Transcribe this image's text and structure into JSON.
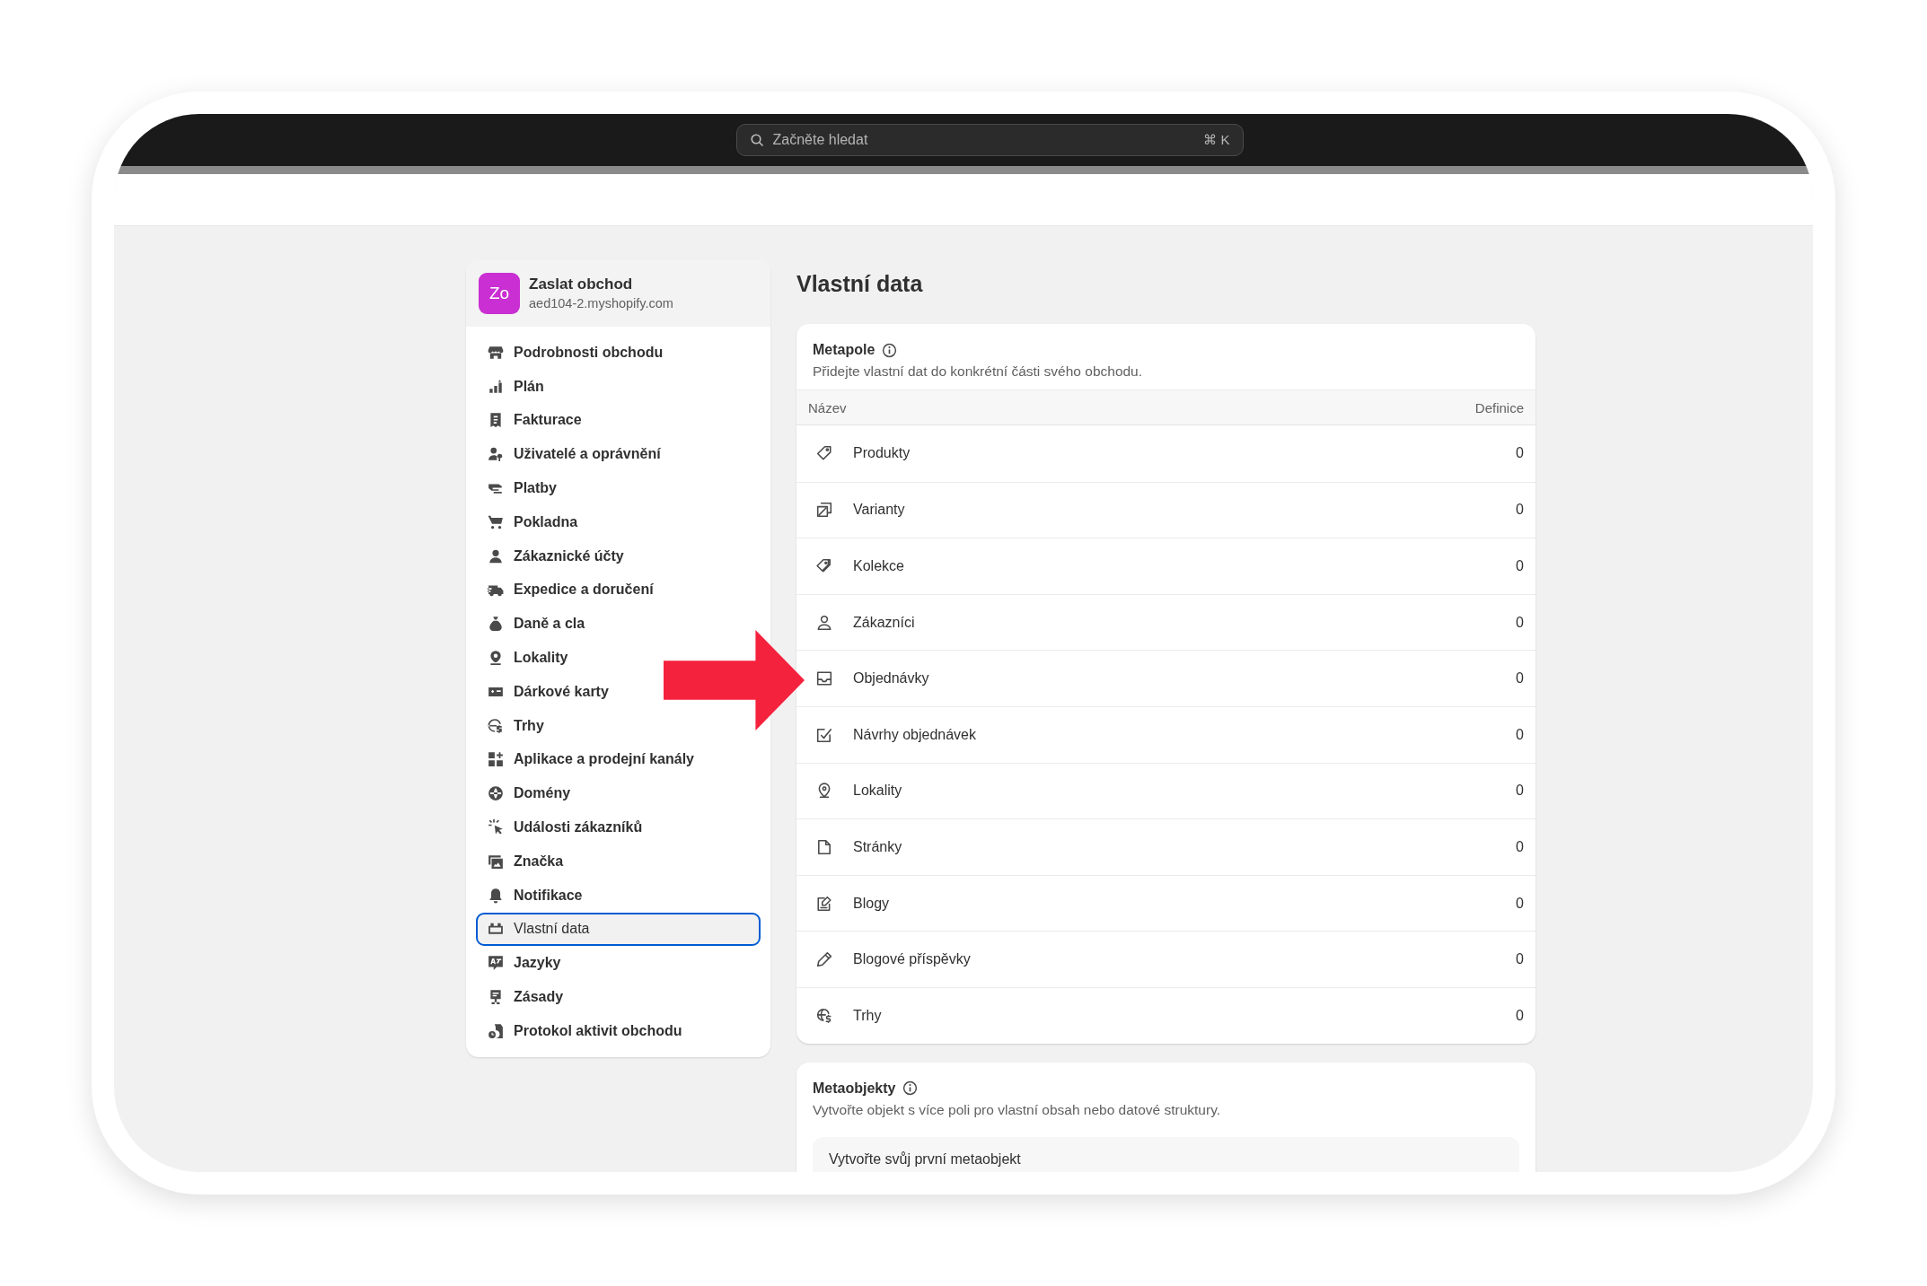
{
  "search": {
    "placeholder": "Začněte hledat",
    "shortcut": "⌘ K"
  },
  "store": {
    "avatar": "Zo",
    "name": "Zaslat obchod",
    "domain": "aed104-2.myshopify.com"
  },
  "sidebar": {
    "items": [
      {
        "label": "Podrobnosti obchodu",
        "selected": false
      },
      {
        "label": "Plán",
        "selected": false
      },
      {
        "label": "Fakturace",
        "selected": false
      },
      {
        "label": "Uživatelé a oprávnění",
        "selected": false
      },
      {
        "label": "Platby",
        "selected": false
      },
      {
        "label": "Pokladna",
        "selected": false
      },
      {
        "label": "Zákaznické účty",
        "selected": false
      },
      {
        "label": "Expedice a doručení",
        "selected": false
      },
      {
        "label": "Daně a cla",
        "selected": false
      },
      {
        "label": "Lokality",
        "selected": false
      },
      {
        "label": "Dárkové karty",
        "selected": false
      },
      {
        "label": "Trhy",
        "selected": false
      },
      {
        "label": "Aplikace a prodejní kanály",
        "selected": false
      },
      {
        "label": "Domény",
        "selected": false
      },
      {
        "label": "Události zákazníků",
        "selected": false
      },
      {
        "label": "Značka",
        "selected": false
      },
      {
        "label": "Notifikace",
        "selected": false
      },
      {
        "label": "Vlastní data",
        "selected": true
      },
      {
        "label": "Jazyky",
        "selected": false
      },
      {
        "label": "Zásady",
        "selected": false
      },
      {
        "label": "Protokol aktivit obchodu",
        "selected": false
      }
    ]
  },
  "page_title": "Vlastní data",
  "metafields": {
    "title": "Metapole",
    "description": "Přidejte vlastní dat do konkrétní části svého obchodu.",
    "columns": [
      "Název",
      "Definice"
    ],
    "rows": [
      {
        "name": "Produkty",
        "count": "0"
      },
      {
        "name": "Varianty",
        "count": "0"
      },
      {
        "name": "Kolekce",
        "count": "0"
      },
      {
        "name": "Zákazníci",
        "count": "0"
      },
      {
        "name": "Objednávky",
        "count": "0"
      },
      {
        "name": "Návrhy objednávek",
        "count": "0"
      },
      {
        "name": "Lokality",
        "count": "0"
      },
      {
        "name": "Stránky",
        "count": "0"
      },
      {
        "name": "Blogy",
        "count": "0"
      },
      {
        "name": "Blogové příspěvky",
        "count": "0"
      },
      {
        "name": "Trhy",
        "count": "0"
      }
    ]
  },
  "metaobjects": {
    "title": "Metaobjekty",
    "description": "Vytvořte objekt s více poli pro vlastní obsah nebo datové struktury.",
    "empty_state": "Vytvořte svůj první metaobjekt"
  }
}
